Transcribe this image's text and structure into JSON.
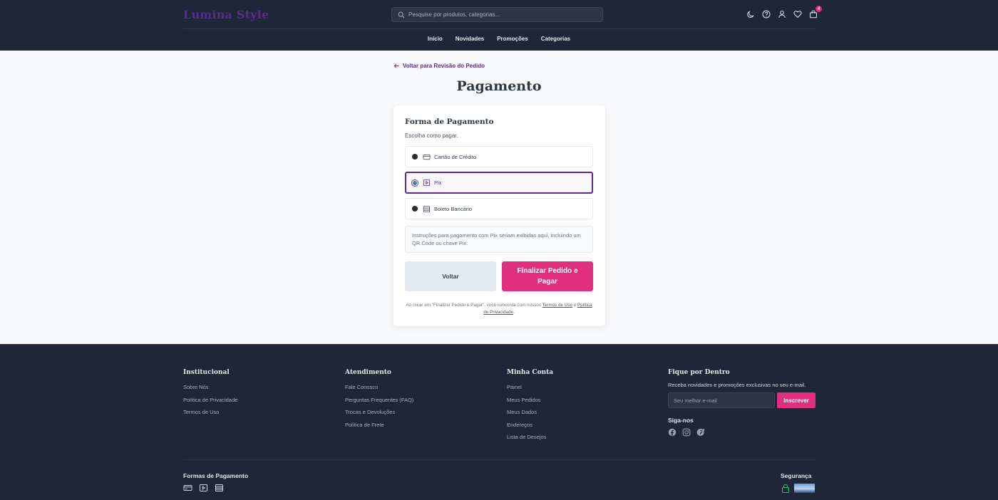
{
  "header": {
    "brand": "Lumina Style",
    "search_placeholder": "Pesquise por produtos, categorias...",
    "cart_count": "4",
    "nav": [
      "Início",
      "Novidades",
      "Promoções",
      "Categorias"
    ]
  },
  "main": {
    "back_link": "Voltar para Revisão do Pedido",
    "title": "Pagamento",
    "card": {
      "title": "Forma de Pagamento",
      "subtitle": "Escolha como pagar.",
      "options": [
        {
          "label": "Cartão de Crédito",
          "icon": "credit-card-icon",
          "selected": false
        },
        {
          "label": "Pix",
          "icon": "pix-icon",
          "selected": true
        },
        {
          "label": "Boleto Bancário",
          "icon": "barcode-icon",
          "selected": false
        }
      ],
      "instructions": "Instruções para pagamento com Pix seriam exibidas aqui, incluindo um QR Code ou chave Pix.",
      "back_button": "Voltar",
      "pay_button": "Finalizar Pedido e Pagar",
      "terms_prefix": "Ao clicar em \"Finalizar Pedido e Pagar\", você concorda com nossos ",
      "terms_link": "Termos de Uso",
      "terms_mid": " e ",
      "privacy_link": "Política de Privacidade",
      "terms_suffix": "."
    }
  },
  "footer": {
    "institucional": {
      "title": "Institucional",
      "links": [
        "Sobre Nós",
        "Política de Privacidade",
        "Termos de Uso"
      ]
    },
    "atendimento": {
      "title": "Atendimento",
      "links": [
        "Fale Conosco",
        "Perguntas Frequentes (FAQ)",
        "Trocas e Devoluções",
        "Política de Frete"
      ]
    },
    "minha_conta": {
      "title": "Minha Conta",
      "links": [
        "Painel",
        "Meus Pedidos",
        "Meus Dados",
        "Endereços",
        "Lista de Desejos"
      ]
    },
    "newsletter": {
      "title": "Fique por Dentro",
      "text": "Receba novidades e promoções exclusivas no seu e-mail.",
      "placeholder": "Seu melhor e-mail",
      "button": "Inscrever",
      "social_title": "Siga-nos"
    },
    "payments_title": "Formas de Pagamento",
    "security_title": "Segurança"
  },
  "colors": {
    "navy": "#1e2638",
    "purple": "#5b2a8f",
    "pink": "#df2f7e"
  }
}
